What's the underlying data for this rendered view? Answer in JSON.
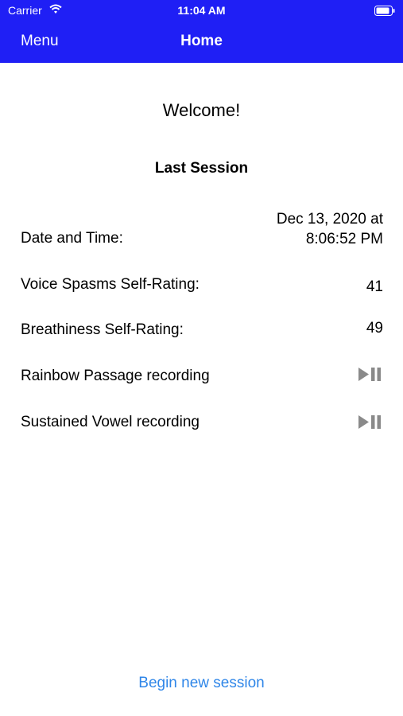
{
  "status_bar": {
    "carrier": "Carrier",
    "time": "11:04 AM"
  },
  "nav": {
    "menu_label": "Menu",
    "title": "Home"
  },
  "main": {
    "welcome": "Welcome!",
    "section_title": "Last Session",
    "date_time": {
      "label": "Date and Time:",
      "value_line1": "Dec 13, 2020 at",
      "value_line2": "8:06:52 PM"
    },
    "voice_spasms": {
      "label": "Voice Spasms Self-Rating:",
      "value": "41"
    },
    "breathiness": {
      "label": "Breathiness Self-Rating:",
      "value": "49"
    },
    "rainbow": {
      "label": "Rainbow Passage recording",
      "icon": "play-pause-icon"
    },
    "vowel": {
      "label": "Sustained Vowel recording",
      "icon": "play-pause-icon"
    }
  },
  "footer": {
    "begin_label": "Begin new session"
  },
  "colors": {
    "nav_bar": "#1f1ff5",
    "link": "#2f86e8",
    "icon_gray": "#8a8a8a"
  }
}
